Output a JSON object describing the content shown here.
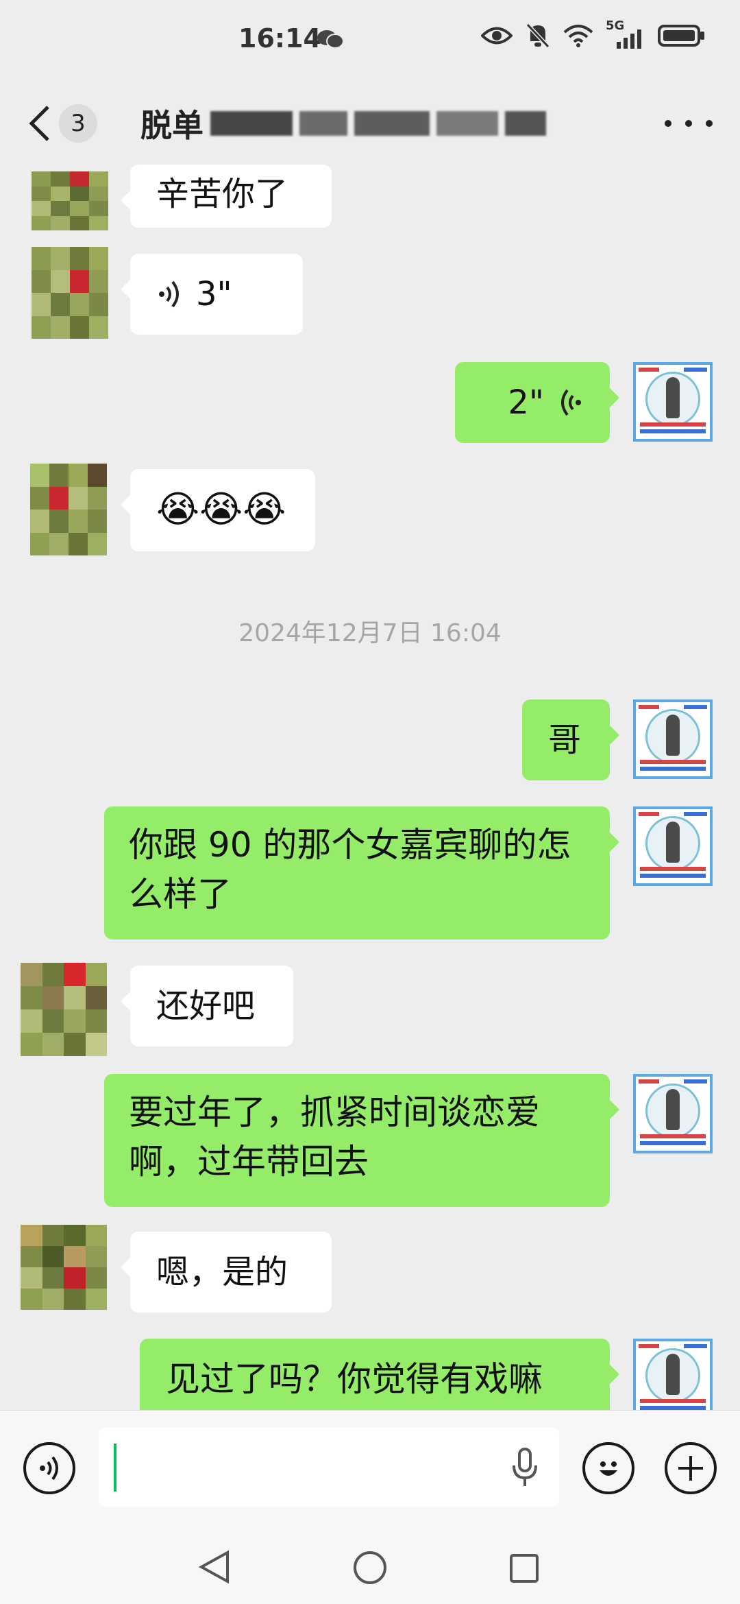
{
  "status_bar": {
    "time": "16:14",
    "network": "5G"
  },
  "nav": {
    "unread_count": "3",
    "title": "脱单"
  },
  "messages": [
    {
      "side": "left",
      "type": "text",
      "text": "辛苦你了"
    },
    {
      "side": "left",
      "type": "voice",
      "text": "3\""
    },
    {
      "side": "right",
      "type": "voice",
      "text": "2\""
    },
    {
      "side": "left",
      "type": "text",
      "text": "😭😭😭"
    },
    {
      "side": "right",
      "type": "text",
      "text": "哥"
    },
    {
      "side": "right",
      "type": "text",
      "text": "你跟 90 的那个女嘉宾聊的怎么样了"
    },
    {
      "side": "left",
      "type": "text",
      "text": "还好吧"
    },
    {
      "side": "right",
      "type": "text",
      "text": "要过年了，抓紧时间谈恋爱啊，过年带回去"
    },
    {
      "side": "left",
      "type": "text",
      "text": "嗯，是的"
    },
    {
      "side": "right",
      "type": "text",
      "text": "见过了吗？你觉得有戏嘛"
    }
  ],
  "timestamp": "2024年12月7日 16:04",
  "colors": {
    "background": "#ededed",
    "bubble_self": "#95ec69",
    "bubble_other": "#ffffff",
    "timestamp_text": "#a6a6a6",
    "cursor": "#07c160"
  },
  "icons": {
    "back": "chevron-left-icon",
    "more": "more-dots-icon",
    "voice_toggle": "voice-icon",
    "mic": "microphone-icon",
    "emoji": "emoji-icon",
    "plus": "plus-icon"
  }
}
